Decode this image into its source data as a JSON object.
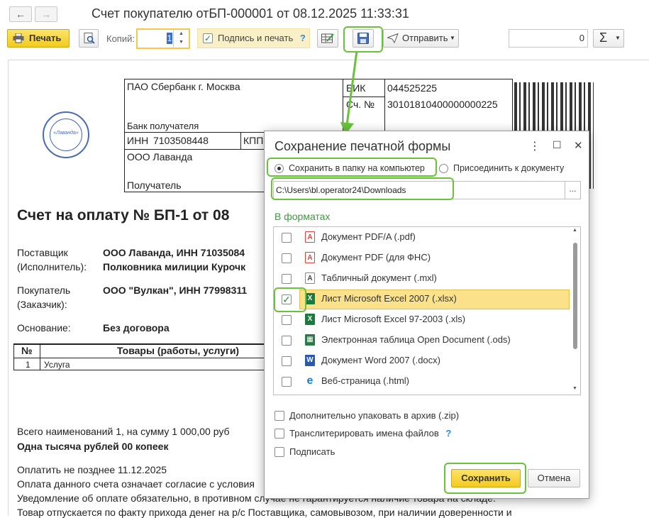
{
  "window": {
    "title": "Счет покупателю отБП-000001 от 08.12.2025 11:33:31",
    "back_glyph": "←",
    "forward_glyph": "→"
  },
  "toolbar": {
    "print_label": "Печать",
    "copies_label": "Копий:",
    "copies_value": "1",
    "sign_print_label": "Подпись и печать",
    "help_glyph": "?",
    "send_label": "Отправить",
    "sum_value": "0",
    "sum_glyph": "Σ"
  },
  "bank_form": {
    "bank_name": "ПАО Сбербанк г. Москва",
    "bank_caption": "Банк получателя",
    "bik_label": "БИК",
    "bik_value": "044525225",
    "acc_label": "Сч. №",
    "acc_value": "30101810400000000225",
    "inn_label": "ИНН",
    "inn_value": "7103508448",
    "kpp_label": "КПП",
    "recipient_name": "ООО Лаванда",
    "recipient_caption": "Получатель"
  },
  "stamp": {
    "text": "«Лаванда»"
  },
  "invoice": {
    "title": "Счет на оплату № БП-1 от 08",
    "supplier_label_1": "Поставщик",
    "supplier_label_2": "(Исполнитель):",
    "supplier_value_1": "ООО Лаванда, ИНН 71035084",
    "supplier_value_2": "Полковника милиции Курочк",
    "buyer_label_1": "Покупатель",
    "buyer_label_2": "(Заказчик):",
    "buyer_value": "ООО \"Вулкан\", ИНН 77998311",
    "basis_label": "Основание:",
    "basis_value": "Без договора",
    "table_headers": [
      "№",
      "Товары (работы, услуги)"
    ],
    "table_rows": [
      [
        "1",
        "Услуга"
      ]
    ],
    "total_line": "Всего наименований 1, на сумму 1 000,00 руб",
    "total_words": "Одна тысяча рублей 00 копеек",
    "note_1": "Оплатить не позднее 11.12.2025",
    "note_2": "Оплата данного счета означает согласие с условия",
    "note_3": "Уведомление об оплате обязательно, в противном случае не гарантируется наличие товара на складе.",
    "note_4": "Товар отпускается по факту прихода денег на р/с Поставщика, самовывозом, при наличии доверенности и"
  },
  "dialog": {
    "title": "Сохранение печатной формы",
    "menu_glyph": "⋮",
    "maximize_glyph": "☐",
    "close_glyph": "✕",
    "radio_save_to_folder": "Сохранить в папку на компьютер",
    "radio_attach": "Присоединить к документу",
    "path_value": "C:\\Users\\bl.operator24\\Downloads",
    "path_browse": "...",
    "formats_label": "В форматах",
    "formats": [
      {
        "label": "Документ PDF/A (.pdf)",
        "icon": "pdf-icon",
        "glyph": "A",
        "checked": false
      },
      {
        "label": "Документ PDF (для ФНС)",
        "icon": "pdf-icon",
        "glyph": "A",
        "checked": false
      },
      {
        "label": "Табличный документ (.mxl)",
        "icon": "spreadsheet-icon",
        "glyph": "A",
        "checked": false
      },
      {
        "label": "Лист Microsoft Excel 2007 (.xlsx)",
        "icon": "excel-icon",
        "glyph": "X",
        "checked": true
      },
      {
        "label": "Лист Microsoft Excel 97-2003 (.xls)",
        "icon": "excel-icon",
        "glyph": "X",
        "checked": false
      },
      {
        "label": "Электронная таблица Open Document (.ods)",
        "icon": "ods-icon",
        "glyph": "▦",
        "checked": false
      },
      {
        "label": "Документ Word 2007 (.docx)",
        "icon": "word-icon",
        "glyph": "W",
        "checked": false
      },
      {
        "label": "Веб-страница (.html)",
        "icon": "edge-icon",
        "glyph": "e",
        "checked": false
      }
    ],
    "opt_zip": "Дополнительно упаковать в архив (.zip)",
    "opt_translit": "Транслитерировать имена файлов",
    "opt_sign": "Подписать",
    "save_label": "Сохранить",
    "cancel_label": "Отмена"
  },
  "colors": {
    "highlight_green": "#6ac23b",
    "accent_yellow": "#f3cb1f",
    "selected_row": "#fbe28a",
    "formats_green": "#3c9a3c"
  }
}
